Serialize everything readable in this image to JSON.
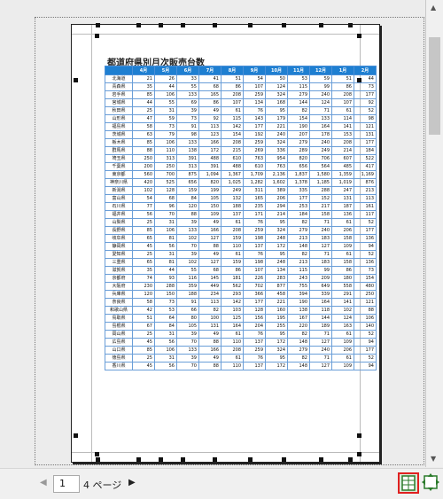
{
  "sheet": {
    "title": "都道府県別月次販売台数",
    "headers": [
      "",
      "4月",
      "5月",
      "6月",
      "7月",
      "8月",
      "9月",
      "10月",
      "11月",
      "12月",
      "1月",
      "2月"
    ],
    "rows": [
      [
        "北海道",
        "21",
        "26",
        "33",
        "41",
        "51",
        "54",
        "50",
        "53",
        "59",
        "51",
        "44"
      ],
      [
        "青森県",
        "35",
        "44",
        "55",
        "68",
        "86",
        "107",
        "124",
        "115",
        "99",
        "86",
        "73"
      ],
      [
        "岩手県",
        "85",
        "106",
        "133",
        "165",
        "208",
        "259",
        "324",
        "279",
        "240",
        "208",
        "177"
      ],
      [
        "宮城県",
        "44",
        "55",
        "69",
        "86",
        "107",
        "134",
        "168",
        "144",
        "124",
        "107",
        "92"
      ],
      [
        "秋田県",
        "25",
        "31",
        "39",
        "49",
        "61",
        "76",
        "95",
        "82",
        "71",
        "61",
        "52"
      ],
      [
        "山形県",
        "47",
        "59",
        "73",
        "92",
        "115",
        "143",
        "179",
        "154",
        "133",
        "114",
        "98"
      ],
      [
        "福島県",
        "58",
        "73",
        "91",
        "113",
        "142",
        "177",
        "221",
        "190",
        "164",
        "141",
        "121"
      ],
      [
        "茨城県",
        "63",
        "79",
        "98",
        "123",
        "154",
        "192",
        "240",
        "207",
        "178",
        "153",
        "131"
      ],
      [
        "栃木県",
        "85",
        "106",
        "133",
        "166",
        "208",
        "259",
        "324",
        "279",
        "240",
        "208",
        "177"
      ],
      [
        "群馬県",
        "88",
        "110",
        "138",
        "172",
        "215",
        "269",
        "336",
        "289",
        "249",
        "214",
        "184"
      ],
      [
        "埼玉県",
        "250",
        "313",
        "391",
        "488",
        "610",
        "763",
        "954",
        "820",
        "706",
        "607",
        "522"
      ],
      [
        "千葉県",
        "200",
        "250",
        "313",
        "391",
        "488",
        "610",
        "763",
        "656",
        "564",
        "485",
        "417"
      ],
      [
        "東京都",
        "560",
        "700",
        "875",
        "1,094",
        "1,367",
        "1,709",
        "2,136",
        "1,837",
        "1,580",
        "1,359",
        "1,169"
      ],
      [
        "神奈川県",
        "420",
        "525",
        "656",
        "820",
        "1,025",
        "1,282",
        "1,602",
        "1,378",
        "1,185",
        "1,019",
        "876"
      ],
      [
        "新潟県",
        "102",
        "128",
        "159",
        "199",
        "249",
        "311",
        "389",
        "335",
        "288",
        "247",
        "213"
      ],
      [
        "富山県",
        "54",
        "68",
        "84",
        "105",
        "132",
        "165",
        "206",
        "177",
        "152",
        "131",
        "113"
      ],
      [
        "石川県",
        "77",
        "96",
        "120",
        "150",
        "188",
        "235",
        "294",
        "253",
        "217",
        "187",
        "161"
      ],
      [
        "福井県",
        "56",
        "70",
        "88",
        "109",
        "137",
        "171",
        "214",
        "184",
        "158",
        "136",
        "117"
      ],
      [
        "山梨県",
        "25",
        "31",
        "39",
        "49",
        "61",
        "76",
        "95",
        "82",
        "71",
        "61",
        "52"
      ],
      [
        "長野県",
        "85",
        "106",
        "133",
        "166",
        "208",
        "259",
        "324",
        "279",
        "240",
        "206",
        "177"
      ],
      [
        "岐阜県",
        "65",
        "81",
        "102",
        "127",
        "159",
        "198",
        "248",
        "213",
        "183",
        "158",
        "136"
      ],
      [
        "静岡県",
        "45",
        "56",
        "70",
        "88",
        "110",
        "137",
        "172",
        "148",
        "127",
        "109",
        "94"
      ],
      [
        "愛知県",
        "25",
        "31",
        "39",
        "49",
        "61",
        "76",
        "95",
        "82",
        "71",
        "61",
        "52"
      ],
      [
        "三重県",
        "65",
        "81",
        "102",
        "127",
        "159",
        "198",
        "248",
        "213",
        "183",
        "158",
        "136"
      ],
      [
        "滋賀県",
        "35",
        "44",
        "55",
        "68",
        "86",
        "107",
        "134",
        "115",
        "99",
        "86",
        "73"
      ],
      [
        "京都府",
        "74",
        "93",
        "116",
        "145",
        "181",
        "226",
        "283",
        "243",
        "209",
        "180",
        "154"
      ],
      [
        "大阪府",
        "230",
        "288",
        "359",
        "449",
        "562",
        "702",
        "877",
        "755",
        "649",
        "558",
        "480"
      ],
      [
        "兵庫県",
        "120",
        "150",
        "188",
        "234",
        "293",
        "366",
        "458",
        "394",
        "339",
        "291",
        "250"
      ],
      [
        "奈良県",
        "58",
        "73",
        "91",
        "113",
        "142",
        "177",
        "221",
        "190",
        "164",
        "141",
        "121"
      ],
      [
        "和歌山県",
        "42",
        "53",
        "66",
        "82",
        "103",
        "128",
        "160",
        "138",
        "118",
        "102",
        "88"
      ],
      [
        "鳥取県",
        "51",
        "64",
        "80",
        "100",
        "125",
        "156",
        "195",
        "167",
        "144",
        "124",
        "106"
      ],
      [
        "島根県",
        "67",
        "84",
        "105",
        "131",
        "164",
        "204",
        "255",
        "220",
        "189",
        "163",
        "140"
      ],
      [
        "岡山県",
        "25",
        "31",
        "39",
        "49",
        "61",
        "76",
        "95",
        "82",
        "71",
        "61",
        "52"
      ],
      [
        "広島県",
        "45",
        "56",
        "70",
        "88",
        "110",
        "137",
        "172",
        "148",
        "127",
        "109",
        "94"
      ],
      [
        "山口県",
        "85",
        "106",
        "133",
        "166",
        "208",
        "259",
        "324",
        "279",
        "240",
        "206",
        "177"
      ],
      [
        "徳島県",
        "25",
        "31",
        "39",
        "49",
        "61",
        "76",
        "95",
        "82",
        "71",
        "61",
        "52"
      ],
      [
        "香川県",
        "45",
        "56",
        "70",
        "88",
        "110",
        "137",
        "172",
        "148",
        "127",
        "109",
        "94"
      ]
    ]
  },
  "status": {
    "prev_icon": "triangle-left-icon",
    "next_icon": "triangle-right-icon",
    "current_page": "1",
    "total_pages": "4 ページ",
    "page_break_preview_icon": "page-break-preview-icon",
    "fit_icon": "fit-to-window-icon"
  },
  "colors": {
    "header_fill": "#1e7fd1",
    "selected_outline": "#e02020"
  }
}
